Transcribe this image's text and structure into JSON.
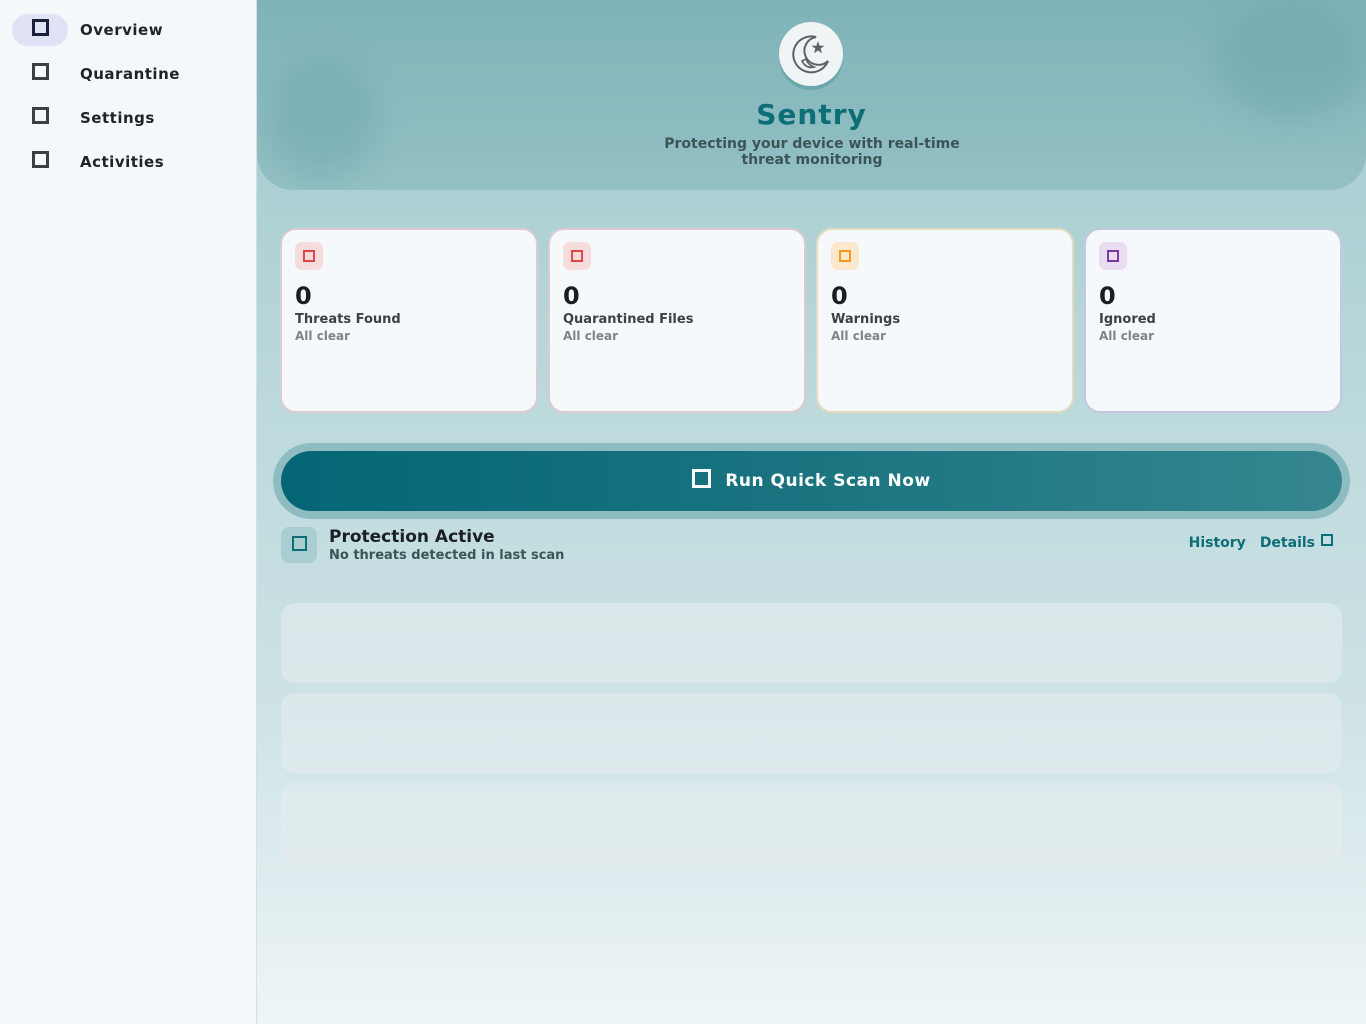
{
  "sidebar": {
    "items": [
      {
        "label": "Overview",
        "icon": "home-icon",
        "active": true
      },
      {
        "label": "Quarantine",
        "icon": "shield-icon",
        "active": false
      },
      {
        "label": "Settings",
        "icon": "gear-icon",
        "active": false
      },
      {
        "label": "Activities",
        "icon": "history-icon",
        "active": false
      }
    ]
  },
  "hero": {
    "logo": "crescent-star-logo",
    "title": "Sentry",
    "subtitle_line1": "Protecting your device with real-time",
    "subtitle_line2": "threat monitoring"
  },
  "cards": [
    {
      "value": "0",
      "title": "Threats Found",
      "sub": "All clear",
      "icon_color": "#e04848",
      "badge_bg": "#f6dcdc"
    },
    {
      "value": "0",
      "title": "Quarantined Files",
      "sub": "All clear",
      "icon_color": "#e04848",
      "badge_bg": "#f6dcdc"
    },
    {
      "value": "0",
      "title": "Warnings",
      "sub": "All clear",
      "icon_color": "#f39a1e",
      "badge_bg": "#fbe8cf"
    },
    {
      "value": "0",
      "title": "Ignored",
      "sub": "All clear",
      "icon_color": "#7a3aa3",
      "badge_bg": "#eadcf1"
    }
  ],
  "scan": {
    "label": "Run Quick Scan Now"
  },
  "status": {
    "title": "Protection Active",
    "subtitle": "No threats detected in last scan",
    "link1": "History",
    "link2": "Details"
  },
  "colors": {
    "accent": "#0d6e78",
    "danger": "#e04848",
    "warning": "#f39a1e",
    "purple": "#7a3aa3"
  }
}
